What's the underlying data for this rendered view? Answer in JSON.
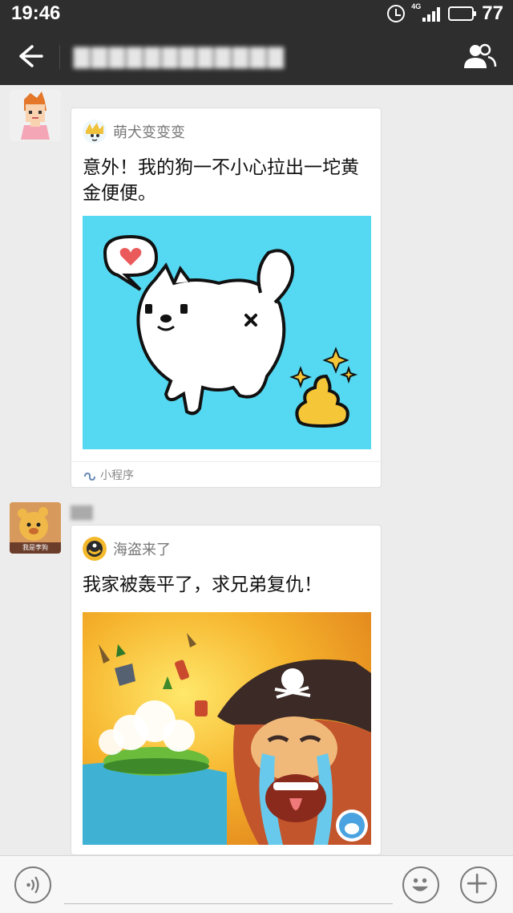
{
  "status_bar": {
    "time": "19:46",
    "network": "4G",
    "battery_level": "77",
    "battery_fraction": 0.77,
    "icons": [
      "alarm-icon",
      "signal-icon",
      "battery-icon"
    ]
  },
  "nav": {
    "back_icon": "arrow-left-icon",
    "title_blurred": "▇▇▇▇▇▇▇▇▇▇▇▇",
    "group_icon": "group-members-icon"
  },
  "messages": [
    {
      "sender_name_blurred": "",
      "avatar_icon": "pixel-girl-avatar",
      "card": {
        "app_name": "萌犬变变变",
        "title": "意外！我的狗一不小心拉出一坨黄金便便。",
        "image_icon": "cartoon-dog-golden-poop-image",
        "footer_label": "小程序",
        "footer_icon": "mini-program-icon"
      }
    },
    {
      "sender_name_blurred": "▇▇",
      "avatar_caption": "我是李狗",
      "card": {
        "app_name": "海盗来了",
        "title": "我家被轰平了，求兄弟复仇！",
        "image_icon": "crying-pirate-island-image"
      }
    }
  ],
  "input_bar": {
    "voice_icon": "voice-icon",
    "emoji_icon": "emoji-icon",
    "plus_icon": "plus-icon",
    "placeholder": ""
  },
  "colors": {
    "bar_dark": "#2e2e2e",
    "chat_bg": "#ececec",
    "card_bg": "#ffffff",
    "image1_bg": "#55d8f1",
    "image2_bg": "#f3a72a"
  }
}
